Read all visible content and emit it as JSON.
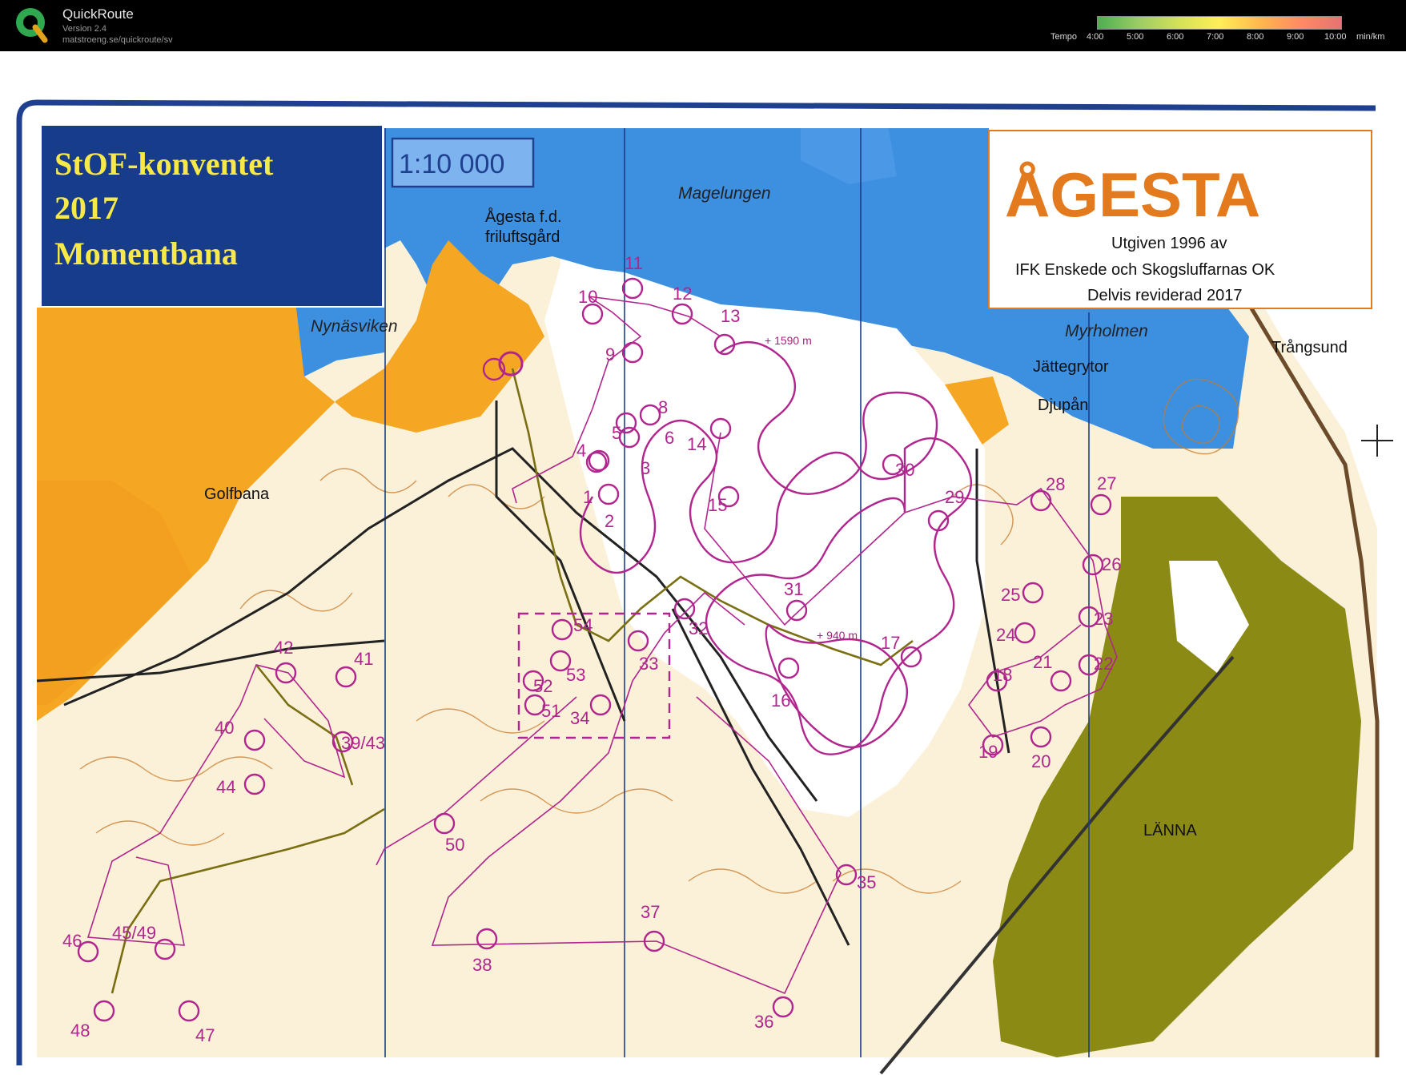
{
  "app": {
    "title": "QuickRoute",
    "version": "Version 2.4",
    "url": "matstroeng.se/quickroute/sv"
  },
  "tempo": {
    "label": "Tempo",
    "ticks": [
      "4:00",
      "5:00",
      "6:00",
      "7:00",
      "8:00",
      "9:00",
      "10:00"
    ],
    "unit": "min/km",
    "colors": [
      "#4caf50",
      "#9ccc65",
      "#d4e157",
      "#ffee58",
      "#ffb74d",
      "#ff8a65",
      "#e57373"
    ]
  },
  "map": {
    "event_title": [
      "StOF-konventet",
      "2017",
      "Momentbana"
    ],
    "scale": "1:10 000",
    "map_name": "ÅGESTA",
    "publisher": [
      "Utgiven 1996 av",
      "IFK  Enskede  och  Skogsluffarnas  OK",
      "Delvis reviderad 2017"
    ],
    "places": {
      "magelungen": "Magelungen",
      "agesta_fd": [
        "Ågesta f.d.",
        "friluftsgård"
      ],
      "nynasviken": "Nynäsviken",
      "myrholmen": "Myrholmen",
      "trangsund": "Trångsund",
      "jattegrytor": "Jättegrytor",
      "djupan": "Djupån",
      "golfbana": "Golfbana",
      "lanna": "LÄNNA"
    },
    "distances": [
      "+ 1590 m",
      "+ 940 m"
    ],
    "controls": [
      "1",
      "2",
      "3",
      "4",
      "5",
      "6",
      "8",
      "9",
      "10",
      "11",
      "12",
      "13",
      "14",
      "15",
      "16",
      "17",
      "18",
      "19",
      "20",
      "21",
      "22",
      "23",
      "24",
      "25",
      "26",
      "27",
      "28",
      "29",
      "30",
      "31",
      "32",
      "33",
      "34",
      "35",
      "36",
      "37",
      "38",
      "39/43",
      "40",
      "41",
      "42",
      "44",
      "45/49",
      "46",
      "47",
      "48",
      "50",
      "51",
      "52",
      "53",
      "54"
    ],
    "colors": {
      "course": "#b1268e",
      "water": "#3d8fe0",
      "open_land": "#f5a623",
      "forest": "#fbf0d8",
      "green": "#8a8a14",
      "frame": "#1f3f8f",
      "title_bg": "#183c8c",
      "title_text": "#f7e948",
      "map_name": "#e37b1e"
    }
  }
}
